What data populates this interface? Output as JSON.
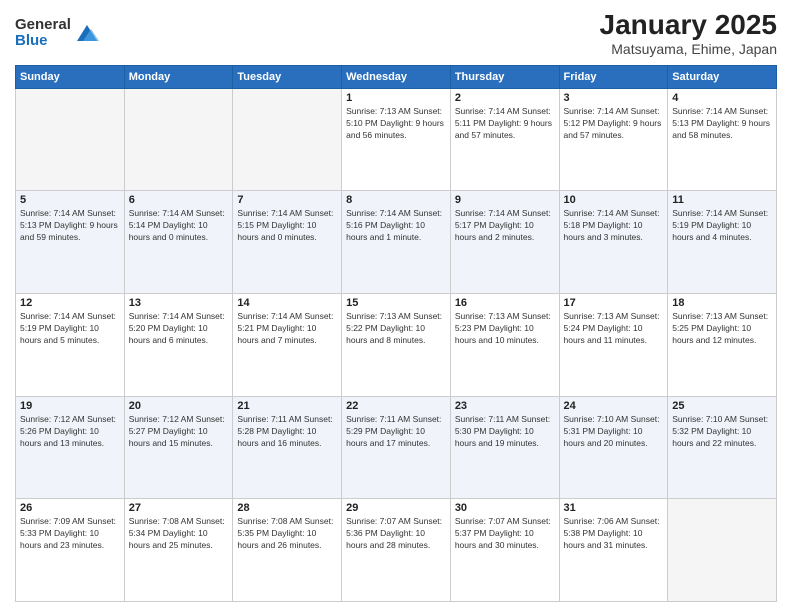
{
  "logo": {
    "general": "General",
    "blue": "Blue"
  },
  "calendar": {
    "title": "January 2025",
    "subtitle": "Matsuyama, Ehime, Japan",
    "weekdays": [
      "Sunday",
      "Monday",
      "Tuesday",
      "Wednesday",
      "Thursday",
      "Friday",
      "Saturday"
    ],
    "weeks": [
      [
        {
          "day": "",
          "info": ""
        },
        {
          "day": "",
          "info": ""
        },
        {
          "day": "",
          "info": ""
        },
        {
          "day": "1",
          "info": "Sunrise: 7:13 AM\nSunset: 5:10 PM\nDaylight: 9 hours\nand 56 minutes."
        },
        {
          "day": "2",
          "info": "Sunrise: 7:14 AM\nSunset: 5:11 PM\nDaylight: 9 hours\nand 57 minutes."
        },
        {
          "day": "3",
          "info": "Sunrise: 7:14 AM\nSunset: 5:12 PM\nDaylight: 9 hours\nand 57 minutes."
        },
        {
          "day": "4",
          "info": "Sunrise: 7:14 AM\nSunset: 5:13 PM\nDaylight: 9 hours\nand 58 minutes."
        }
      ],
      [
        {
          "day": "5",
          "info": "Sunrise: 7:14 AM\nSunset: 5:13 PM\nDaylight: 9 hours\nand 59 minutes."
        },
        {
          "day": "6",
          "info": "Sunrise: 7:14 AM\nSunset: 5:14 PM\nDaylight: 10 hours\nand 0 minutes."
        },
        {
          "day": "7",
          "info": "Sunrise: 7:14 AM\nSunset: 5:15 PM\nDaylight: 10 hours\nand 0 minutes."
        },
        {
          "day": "8",
          "info": "Sunrise: 7:14 AM\nSunset: 5:16 PM\nDaylight: 10 hours\nand 1 minute."
        },
        {
          "day": "9",
          "info": "Sunrise: 7:14 AM\nSunset: 5:17 PM\nDaylight: 10 hours\nand 2 minutes."
        },
        {
          "day": "10",
          "info": "Sunrise: 7:14 AM\nSunset: 5:18 PM\nDaylight: 10 hours\nand 3 minutes."
        },
        {
          "day": "11",
          "info": "Sunrise: 7:14 AM\nSunset: 5:19 PM\nDaylight: 10 hours\nand 4 minutes."
        }
      ],
      [
        {
          "day": "12",
          "info": "Sunrise: 7:14 AM\nSunset: 5:19 PM\nDaylight: 10 hours\nand 5 minutes."
        },
        {
          "day": "13",
          "info": "Sunrise: 7:14 AM\nSunset: 5:20 PM\nDaylight: 10 hours\nand 6 minutes."
        },
        {
          "day": "14",
          "info": "Sunrise: 7:14 AM\nSunset: 5:21 PM\nDaylight: 10 hours\nand 7 minutes."
        },
        {
          "day": "15",
          "info": "Sunrise: 7:13 AM\nSunset: 5:22 PM\nDaylight: 10 hours\nand 8 minutes."
        },
        {
          "day": "16",
          "info": "Sunrise: 7:13 AM\nSunset: 5:23 PM\nDaylight: 10 hours\nand 10 minutes."
        },
        {
          "day": "17",
          "info": "Sunrise: 7:13 AM\nSunset: 5:24 PM\nDaylight: 10 hours\nand 11 minutes."
        },
        {
          "day": "18",
          "info": "Sunrise: 7:13 AM\nSunset: 5:25 PM\nDaylight: 10 hours\nand 12 minutes."
        }
      ],
      [
        {
          "day": "19",
          "info": "Sunrise: 7:12 AM\nSunset: 5:26 PM\nDaylight: 10 hours\nand 13 minutes."
        },
        {
          "day": "20",
          "info": "Sunrise: 7:12 AM\nSunset: 5:27 PM\nDaylight: 10 hours\nand 15 minutes."
        },
        {
          "day": "21",
          "info": "Sunrise: 7:11 AM\nSunset: 5:28 PM\nDaylight: 10 hours\nand 16 minutes."
        },
        {
          "day": "22",
          "info": "Sunrise: 7:11 AM\nSunset: 5:29 PM\nDaylight: 10 hours\nand 17 minutes."
        },
        {
          "day": "23",
          "info": "Sunrise: 7:11 AM\nSunset: 5:30 PM\nDaylight: 10 hours\nand 19 minutes."
        },
        {
          "day": "24",
          "info": "Sunrise: 7:10 AM\nSunset: 5:31 PM\nDaylight: 10 hours\nand 20 minutes."
        },
        {
          "day": "25",
          "info": "Sunrise: 7:10 AM\nSunset: 5:32 PM\nDaylight: 10 hours\nand 22 minutes."
        }
      ],
      [
        {
          "day": "26",
          "info": "Sunrise: 7:09 AM\nSunset: 5:33 PM\nDaylight: 10 hours\nand 23 minutes."
        },
        {
          "day": "27",
          "info": "Sunrise: 7:08 AM\nSunset: 5:34 PM\nDaylight: 10 hours\nand 25 minutes."
        },
        {
          "day": "28",
          "info": "Sunrise: 7:08 AM\nSunset: 5:35 PM\nDaylight: 10 hours\nand 26 minutes."
        },
        {
          "day": "29",
          "info": "Sunrise: 7:07 AM\nSunset: 5:36 PM\nDaylight: 10 hours\nand 28 minutes."
        },
        {
          "day": "30",
          "info": "Sunrise: 7:07 AM\nSunset: 5:37 PM\nDaylight: 10 hours\nand 30 minutes."
        },
        {
          "day": "31",
          "info": "Sunrise: 7:06 AM\nSunset: 5:38 PM\nDaylight: 10 hours\nand 31 minutes."
        },
        {
          "day": "",
          "info": ""
        }
      ]
    ]
  }
}
